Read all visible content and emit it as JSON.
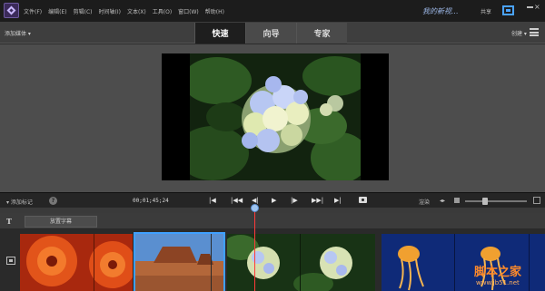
{
  "titlebar": {
    "menu": [
      "文件(F)",
      "编辑(E)",
      "剪辑(C)",
      "时间轴(I)",
      "文本(X)",
      "工具(O)",
      "窗口(W)",
      "帮助(H)"
    ],
    "project_name": "我的新视...",
    "share_label": "共享"
  },
  "modebar": {
    "add_media": "添加媒体",
    "tabs": [
      "快速",
      "向导",
      "专家"
    ],
    "active_tab": "快速",
    "create_label": "创建"
  },
  "transport": {
    "add_marker": "添加标记",
    "timecode": "00;01;45;24",
    "render_label": "渲染",
    "zoom_level": 0.3
  },
  "timeline": {
    "title_placeholder": "放置字幕"
  },
  "watermark": {
    "text": "脚本之家",
    "url": "www.jb51.net"
  },
  "colors": {
    "accent": "#3fa0ff",
    "playhead": "#ff3a3a",
    "active_tab_bg": "#1e1e1e"
  }
}
